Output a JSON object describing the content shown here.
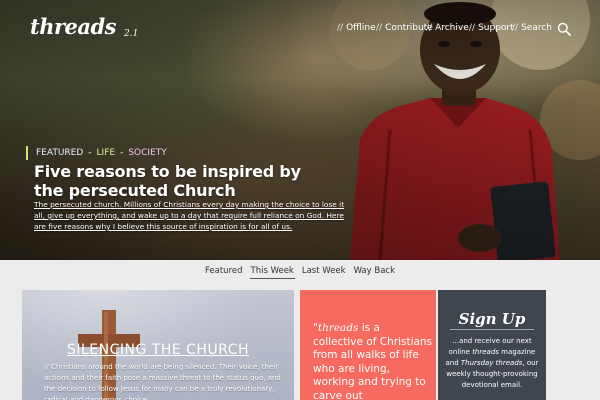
{
  "header": {
    "logo_text": "threads",
    "logo_version": "2.1",
    "nav": [
      {
        "slash": "//",
        "label": "Offline"
      },
      {
        "slash": "//",
        "label": "Contribute"
      },
      {
        "slash": "//",
        "label": "Archive"
      },
      {
        "slash": "//",
        "label": "Support"
      },
      {
        "slash": "//",
        "label": "Search"
      }
    ],
    "search_icon": "search-icon"
  },
  "hero": {
    "tags": [
      "FEATURED",
      "LIFE",
      "SOCIETY"
    ],
    "tag_separator": "-",
    "title": "Five reasons to be inspired by the persecuted Church",
    "lede": "The persecuted church. Millions of Christians every day making the choice to lose it all, give up everything, and wake up to a day that require full reliance on God. Here are five reasons why I believe this source of inspiration is for all of us."
  },
  "tabs": {
    "items": [
      "Featured",
      "This Week",
      "Last Week",
      "Way Back"
    ],
    "active": "This Week"
  },
  "cards": {
    "card1": {
      "title": "SILENCING THE CHURCH",
      "excerpt": "// Christians around the world are being silenced. Their voice, their actions and their faith pose a massive threat to the status quo, and the decision to follow Jesus for many can be a truly revolutionary, radical and dangerous choice."
    },
    "card2": {
      "open_quote": "\"",
      "brand": "threads",
      "text": " is a collective of Christians from all walks of life who are living, working and trying to carve out"
    },
    "card3": {
      "heading": "Sign Up",
      "desc_lead": "...and receive our next online ",
      "desc_brand1": "threads",
      "desc_mid": " magazine and ",
      "desc_brand2": "Thursday threads",
      "desc_tail": ", our weekly thought-provoking devotional email."
    }
  },
  "colors": {
    "accent_lime": "#d7e26e",
    "coral": "#f66a5f",
    "slate": "#3f464e",
    "page_bg": "#ececec"
  }
}
